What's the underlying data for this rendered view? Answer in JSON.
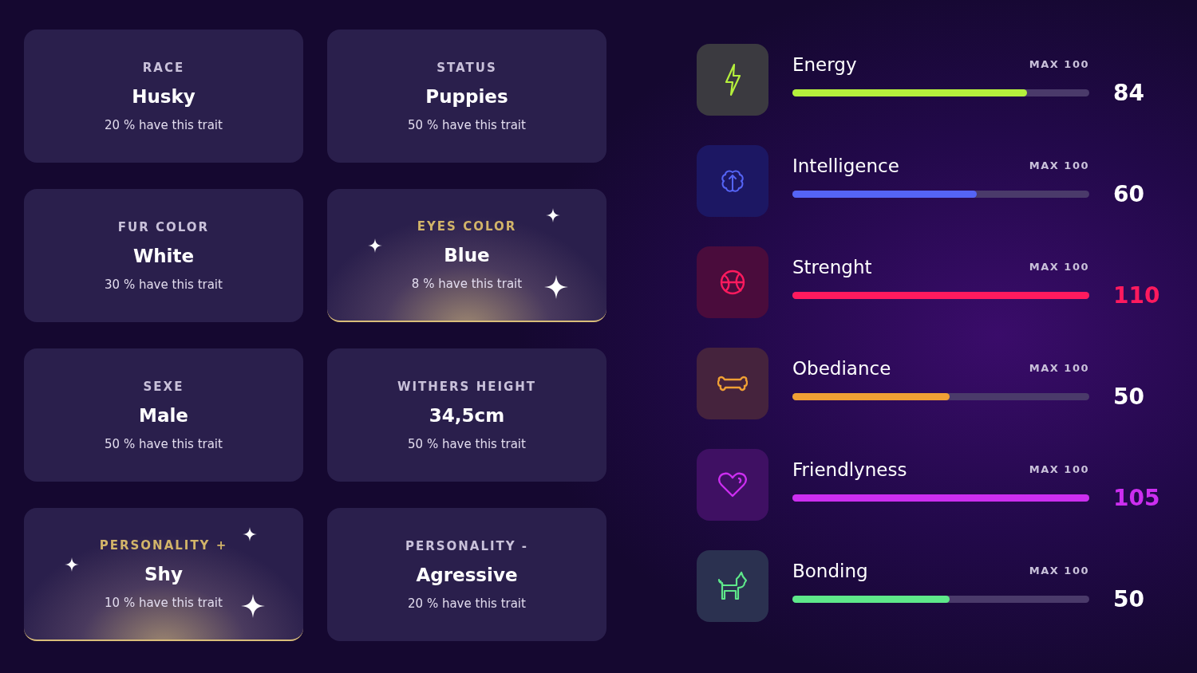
{
  "traits": [
    {
      "label": "RACE",
      "value": "Husky",
      "share": "20 % have this trait",
      "rare": false
    },
    {
      "label": "STATUS",
      "value": "Puppies",
      "share": "50 % have this trait",
      "rare": false
    },
    {
      "label": "FUR COLOR",
      "value": "White",
      "share": "30 % have this trait",
      "rare": false
    },
    {
      "label": "EYES COLOR",
      "value": "Blue",
      "share": "8 % have this trait",
      "rare": true
    },
    {
      "label": "SEXE",
      "value": "Male",
      "share": "50 % have this trait",
      "rare": false
    },
    {
      "label": "WITHERS HEIGHT",
      "value": "34,5cm",
      "share": "50 % have this trait",
      "rare": false
    },
    {
      "label": "PERSONALITY +",
      "value": "Shy",
      "share": "10 % have this trait",
      "rare": true
    },
    {
      "label": "PERSONALITY -",
      "value": "Agressive",
      "share": "20 % have this trait",
      "rare": false
    }
  ],
  "stats": [
    {
      "kind": "energy",
      "name": "Energy",
      "max": "MAX 100",
      "level": 0.79,
      "value": "84",
      "color": "#b5f03c",
      "over": false
    },
    {
      "kind": "intelligence",
      "name": "Intelligence",
      "max": "MAX 100",
      "level": 0.62,
      "value": "60",
      "color": "#5564f5",
      "over": false
    },
    {
      "kind": "strength",
      "name": "Strenght",
      "max": "MAX 100",
      "level": 1,
      "value": "110",
      "color": "#ff1a5e",
      "over": true
    },
    {
      "kind": "obedience",
      "name": "Obediance",
      "max": "MAX 100",
      "level": 0.53,
      "value": "50",
      "color": "#f0a034",
      "over": false
    },
    {
      "kind": "friendliness",
      "name": "Friendlyness",
      "max": "MAX 100",
      "level": 1,
      "value": "105",
      "color": "#cc2ef0",
      "over": true
    },
    {
      "kind": "bonding",
      "name": "Bonding",
      "max": "MAX 100",
      "level": 0.53,
      "value": "50",
      "color": "#5ee88a",
      "over": false
    }
  ]
}
